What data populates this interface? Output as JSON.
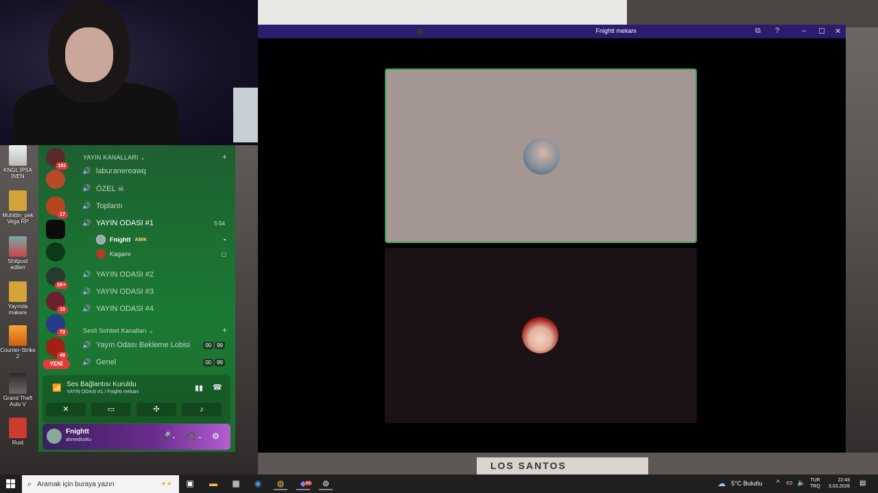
{
  "desktop_icons": [
    {
      "label": "KNGL İPSA İNEN"
    },
    {
      "label": "Muhittin_pek Vega RP"
    },
    {
      "label": "Shitpost edilen"
    },
    {
      "label": "Yayında makare"
    },
    {
      "label": "Counter-Strike 2"
    },
    {
      "label": "Grand Theft Auto V"
    },
    {
      "label": "Rust"
    }
  ],
  "servers": {
    "badges": [
      "191",
      "17",
      "1K+",
      "15",
      "73",
      "49"
    ],
    "new_label": "YENİ"
  },
  "channels": {
    "category1": "YAYIN KANALLARI",
    "items": [
      {
        "name": "laburanereawq"
      },
      {
        "name": "ÖZEL ☠"
      },
      {
        "name": "Toplantı"
      },
      {
        "name": "YAYIN ODASI #1",
        "time": "5:54"
      },
      {
        "name": "YAYIN ODASI #2"
      },
      {
        "name": "YAYIN ODASI #3"
      },
      {
        "name": "YAYIN ODASI #4"
      }
    ],
    "members": [
      {
        "name": "Fnightt",
        "tag": "AMIK"
      },
      {
        "name": "Kagami"
      }
    ],
    "category2": "Sesli Sohbet Kanalları",
    "items2": [
      {
        "name": "Yayın Odası Bekleme Lobisi",
        "cnt_a": "00",
        "cnt_b": "99"
      },
      {
        "name": "Genel",
        "cnt_a": "00",
        "cnt_b": "99"
      }
    ]
  },
  "voice_panel": {
    "title": "Ses Bağlantısı Kuruldu",
    "subtitle": "YAYIN ODASI #1 / Fnightt mekanı"
  },
  "user_panel": {
    "name": "Fnightt",
    "sub": "ahmedturku"
  },
  "call_window": {
    "title": "Fnightt mekanı"
  },
  "taskbar": {
    "search_placeholder": "Aramak için buraya yazın",
    "weather": "5°C Bulutlu",
    "lang_top": "TUR",
    "lang_bottom": "TRQ",
    "time": "22:43",
    "date": "3.03.2026",
    "chrome_badge": "93"
  },
  "colors": {
    "discord_green": "#1a7a33",
    "speaking_border": "#3ba55d",
    "title_bar": "#2c1c6e",
    "badge_red": "#e03a3a"
  }
}
